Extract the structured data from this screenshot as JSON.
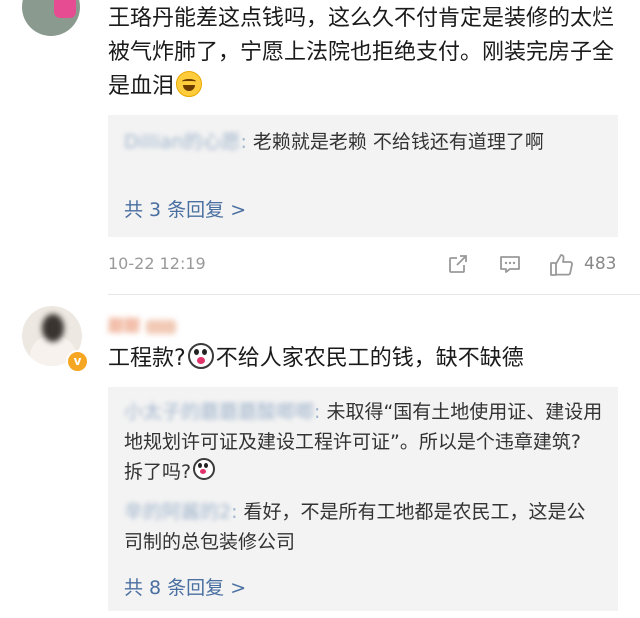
{
  "comments": [
    {
      "text_before_emoji": "王珞丹能差这点钱吗，这么久不付肯定是装修的太烂被气炸肺了，宁愿上法院也拒绝支付。刚装完房子全是血泪",
      "emoji": "laugh-cry-icon",
      "replies": [
        {
          "username": "Dillian的心愿",
          "separator": ":",
          "text": " 老赖就是老赖 不给钱还有道理了啊"
        }
      ],
      "more_replies": "共 3 条回复 >",
      "time": "10-22 12:19",
      "likes": "483"
    },
    {
      "author": "甜甜",
      "text_before_emoji": "工程款?",
      "emoji": "shocked-face-icon",
      "text_after_emoji": "不给人家农民工的钱，缺不缺德",
      "replies": [
        {
          "username": "小太子的蘑蘑蘑酸唧唧",
          "separator": ":",
          "text": " 未取得“国有土地使用证、建设用地规划许可证及建设工程许可证”。所以是个违章建筑? 拆了吗?",
          "emoji": "shocked-face-icon"
        },
        {
          "username": "辛的阿酱的2",
          "separator": ":",
          "text": " 看好，不是所有工地都是农民工，这是公司制的总包装修公司"
        }
      ],
      "more_replies": "共 8 条回复 >"
    }
  ],
  "colors": {
    "link": "#4a6fa1",
    "reply_bg": "#f3f3f3",
    "meta": "#999999",
    "verified_badge": "#f5a623"
  }
}
